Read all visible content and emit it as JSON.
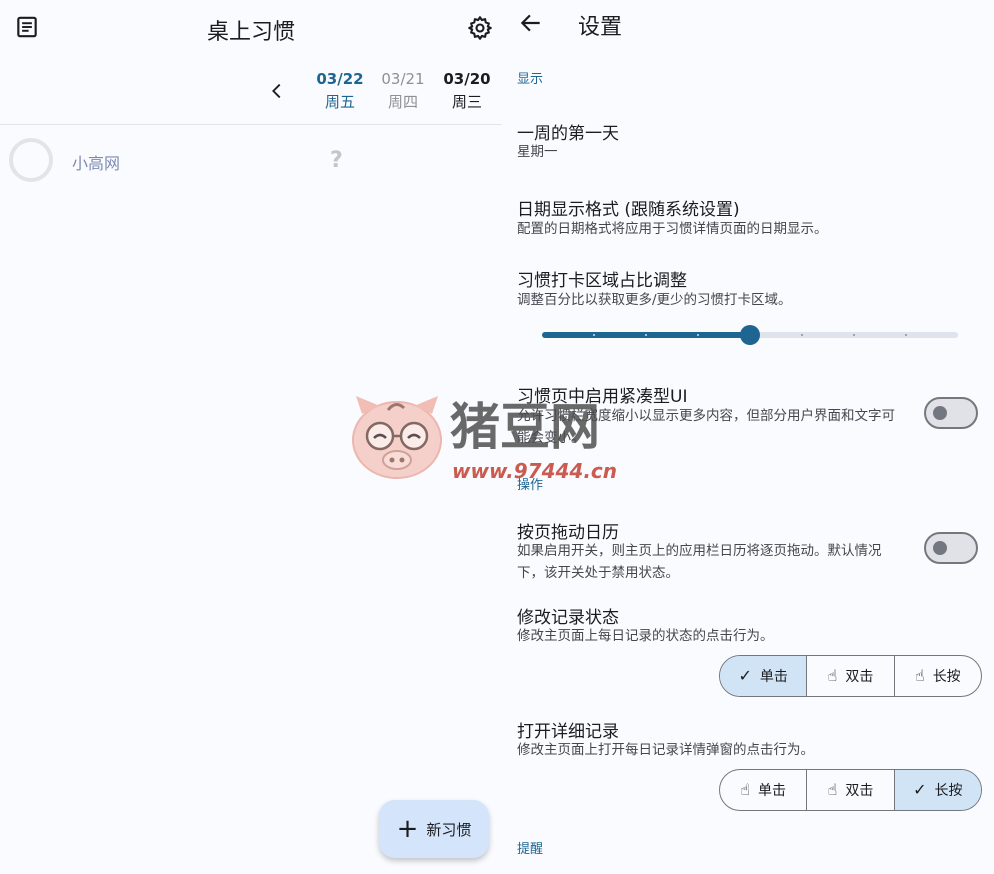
{
  "colors": {
    "accent": "#1f6591",
    "accent_container": "#d0e4f6",
    "fab_bg": "#d3e4fb",
    "muted": "#9a9ca1"
  },
  "left": {
    "title": "桌上习惯",
    "dates": [
      {
        "date": "03/22",
        "weekday": "周五",
        "active": true
      },
      {
        "date": "03/21",
        "weekday": "周四",
        "active": false
      },
      {
        "date": "03/20",
        "weekday": "周三",
        "active": false
      }
    ],
    "habits": [
      {
        "name": "小高网",
        "status": "?"
      }
    ],
    "fab": {
      "icon": "plus-icon",
      "label": "新习惯"
    }
  },
  "settings": {
    "title": "设置",
    "sections": {
      "display": "显示",
      "actions": "操作",
      "reminder": "提醒"
    },
    "first_day": {
      "title": "一周的第一天",
      "value": "星期一"
    },
    "date_format": {
      "title": "日期显示格式 (跟随系统设置)",
      "desc": "配置的日期格式将应用于习惯详情页面的日期显示。"
    },
    "area_ratio": {
      "title": "习惯打卡区域占比调整",
      "desc": "调整百分比以获取更多/更少的习惯打卡区域。",
      "slider_fraction": 0.5,
      "slider_steps": 8
    },
    "compact_ui": {
      "title": "习惯页中启用紧凑型UI",
      "desc": "允许习惯栏宽度缩小以显示更多内容，但部分用户界面和文字可能会变小。",
      "enabled": false
    },
    "page_drag": {
      "title": "按页拖动日历",
      "desc": "如果启用开关，则主页上的应用栏日历将逐页拖动。默认情况下，该开关处于禁用状态。",
      "enabled": false
    },
    "record_status": {
      "title": "修改记录状态",
      "desc": "修改主页面上每日记录的状态的点击行为。",
      "options": [
        {
          "label": "单击",
          "icon": "check-icon",
          "selected": true
        },
        {
          "label": "双击",
          "icon": "double-tap-icon",
          "selected": false
        },
        {
          "label": "长按",
          "icon": "long-press-icon",
          "selected": false
        }
      ]
    },
    "open_detail": {
      "title": "打开详细记录",
      "desc": "修改主页面上打开每日记录详情弹窗的点击行为。",
      "options": [
        {
          "label": "单击",
          "icon": "tap-icon",
          "selected": false
        },
        {
          "label": "双击",
          "icon": "double-tap-icon",
          "selected": false
        },
        {
          "label": "长按",
          "icon": "check-icon",
          "selected": true
        }
      ]
    }
  },
  "watermark": {
    "brand": "猪豆网",
    "url": "www.97444.cn"
  }
}
